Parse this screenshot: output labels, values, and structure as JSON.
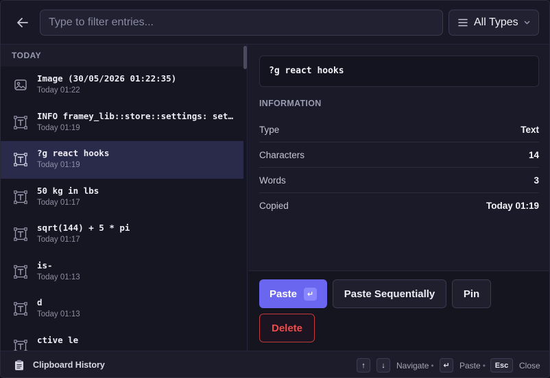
{
  "header": {
    "search_placeholder": "Type to filter entries...",
    "type_filter": "All Types"
  },
  "list": {
    "section": "TODAY",
    "items": [
      {
        "title": "Image (30/05/2026 01:22:35)",
        "time": "Today 01:22",
        "icon": "image-icon"
      },
      {
        "title": "INFO framey_lib::store::settings: setti…",
        "time": "Today 01:19",
        "icon": "text-icon"
      },
      {
        "title": "?g react hooks",
        "time": "Today 01:19",
        "icon": "text-icon",
        "selected": true
      },
      {
        "title": "50 kg in lbs",
        "time": "Today 01:17",
        "icon": "text-icon"
      },
      {
        "title": "sqrt(144) + 5 * pi",
        "time": "Today 01:17",
        "icon": "text-icon"
      },
      {
        "title": "is-",
        "time": "Today 01:13",
        "icon": "text-icon"
      },
      {
        "title": "d",
        "time": "Today 01:13",
        "icon": "text-icon"
      },
      {
        "title": "ctive le",
        "time": "",
        "icon": "text-icon"
      }
    ]
  },
  "detail": {
    "preview": "?g react hooks",
    "info_heading": "INFORMATION",
    "rows": [
      {
        "key": "Type",
        "value": "Text"
      },
      {
        "key": "Characters",
        "value": "14"
      },
      {
        "key": "Words",
        "value": "3"
      },
      {
        "key": "Copied",
        "value": "Today 01:19"
      }
    ]
  },
  "actions": {
    "paste": "Paste",
    "paste_key": "↵",
    "paste_sequentially": "Paste Sequentially",
    "pin": "Pin",
    "delete": "Delete"
  },
  "footer": {
    "title": "Clipboard History",
    "up_key": "↑",
    "down_key": "↓",
    "navigate": "Navigate",
    "enter_key": "↵",
    "paste": "Paste",
    "esc_key": "Esc",
    "close": "Close",
    "separator": "•"
  },
  "colors": {
    "accent": "#6a66f0",
    "danger": "#ef4b4b",
    "selected_row": "#2a2a4a",
    "background": "#171724"
  }
}
